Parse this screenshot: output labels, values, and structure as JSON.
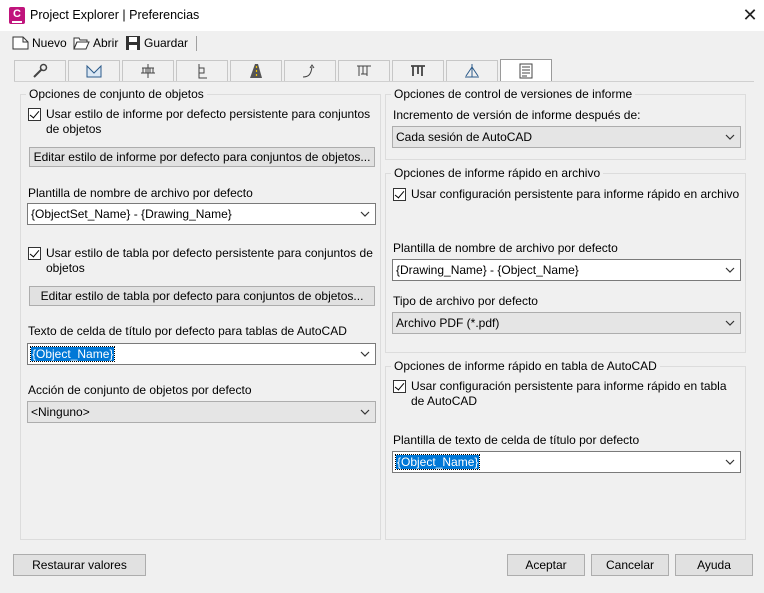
{
  "window": {
    "title": "Project Explorer | Preferencias"
  },
  "toolbar": {
    "new_label": "Nuevo",
    "open_label": "Abrir",
    "save_label": "Guardar"
  },
  "icons": {
    "app": "autocad-c-icon",
    "close": "close-icon",
    "new": "new-document-icon",
    "open": "open-folder-icon",
    "save": "save-disk-icon",
    "tabs": [
      "wrench-icon",
      "surface-icon",
      "alignment-icon",
      "profile-icon",
      "road-icon",
      "corridor-icon",
      "pipe-network-icon",
      "pressure-network-icon",
      "survey-icon",
      "report-icon"
    ]
  },
  "left_group": {
    "title": "Opciones de conjunto de objetos",
    "persist_report_style_label": "Usar estilo de informe por defecto persistente para conjuntos de objetos",
    "edit_report_style_button": "Editar estilo de informe por defecto para conjuntos de objetos...",
    "filename_template_label": "Plantilla de nombre de archivo por defecto",
    "filename_template_value": "{ObjectSet_Name} - {Drawing_Name}",
    "persist_table_style_label": "Usar estilo de tabla por defecto persistente para conjuntos de objetos",
    "edit_table_style_button": "Editar estilo de tabla por defecto para conjuntos de objetos...",
    "title_cell_text_label": "Texto de celda de título por defecto para tablas de AutoCAD",
    "title_cell_text_value": "{Object_Name}",
    "default_action_label": "Acción de conjunto de objetos por defecto",
    "default_action_value": "<Ninguno>"
  },
  "version_group": {
    "title": "Opciones de control de versiones de informe",
    "increment_label": "Incremento de versión de informe después de:",
    "increment_value": "Cada sesión de AutoCAD"
  },
  "quick_file_group": {
    "title": "Opciones de informe rápido en archivo",
    "persist_label": "Usar configuración persistente para informe rápido en archivo",
    "filename_template_label": "Plantilla de nombre de archivo por defecto",
    "filename_template_value": "{Drawing_Name} - {Object_Name}",
    "filetype_label": "Tipo de archivo por defecto",
    "filetype_value": "Archivo PDF (*.pdf)"
  },
  "quick_table_group": {
    "title": "Opciones de informe rápido en tabla de AutoCAD",
    "persist_label": "Usar configuración persistente para informe rápido en tabla de AutoCAD",
    "title_cell_template_label": "Plantilla de texto de celda de título por defecto",
    "title_cell_template_value": "{Object_Name}"
  },
  "footer": {
    "restore_label": "Restaurar valores",
    "ok_label": "Aceptar",
    "cancel_label": "Cancelar",
    "help_label": "Ayuda"
  },
  "colors": {
    "app_icon": "#c0147c",
    "selection": "#0078d7",
    "window_bg": "#f0f0f0"
  }
}
